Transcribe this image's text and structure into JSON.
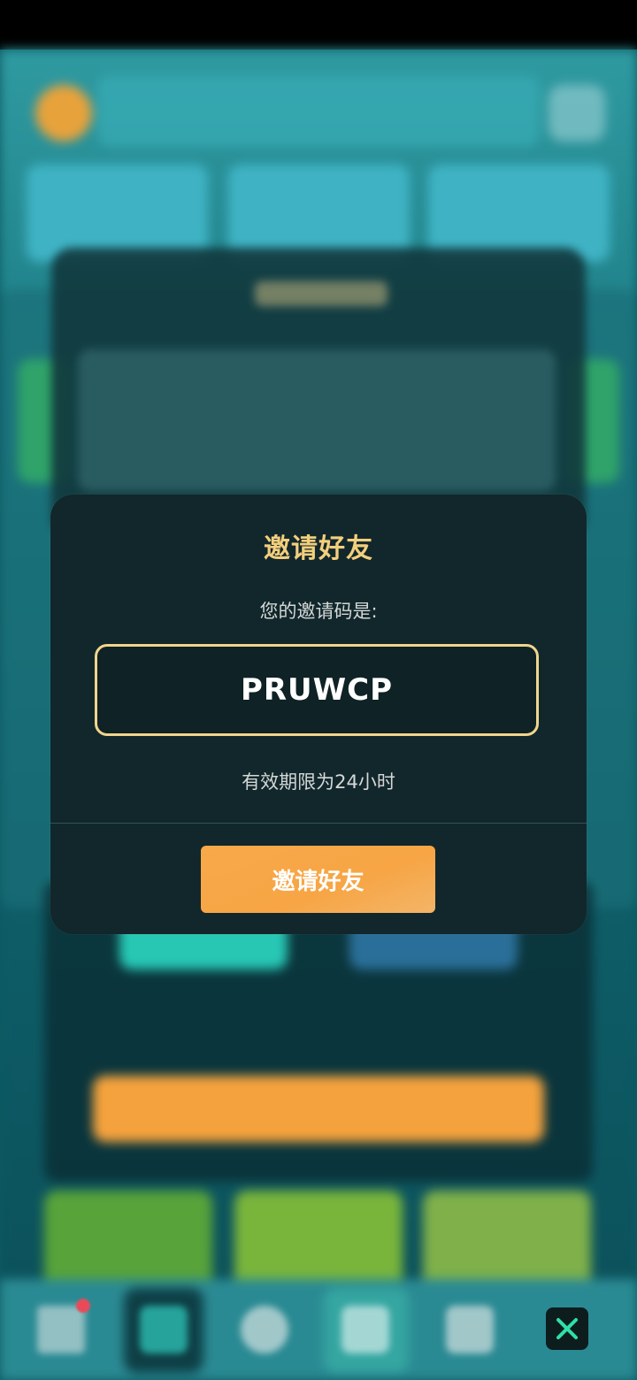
{
  "modal": {
    "title": "邀请好友",
    "code_label": "您的邀请码是:",
    "invite_code": "PRUWCP",
    "validity_text": "有效期限为24小时",
    "invite_button_label": "邀请好友"
  },
  "colors": {
    "title": "#f3cf7d",
    "code_border": "#f1d58d",
    "button": "#f8a94a",
    "modal_bg": "#12272b",
    "close_icon": "#2fe0a6"
  },
  "icons": {
    "close": "close-icon"
  }
}
